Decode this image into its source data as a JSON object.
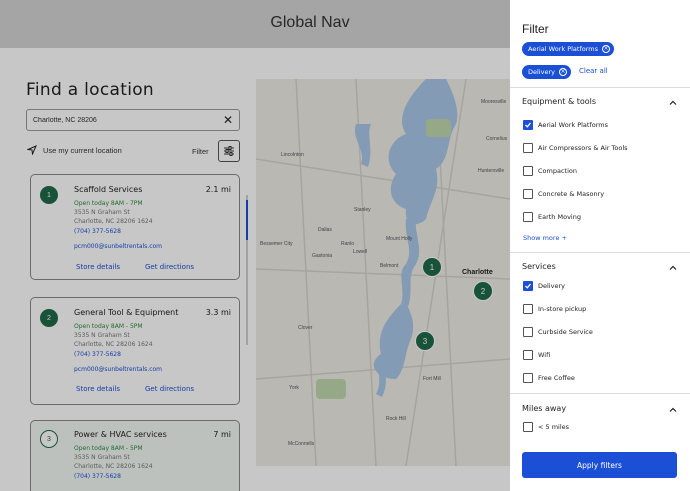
{
  "nav": {
    "title": "Global Nav"
  },
  "left": {
    "title": "Find a location",
    "search_value": "Charlotte, NC 28206",
    "use_location": "Use my current location",
    "filter_label": "Filter"
  },
  "cards": [
    {
      "num": "1",
      "name": "Scaffold Services",
      "dist": "2.1 mi",
      "open": "Open today 8AM - 7PM",
      "addr1": "3535 N Graham St",
      "addr2": "Charlotte, NC  28206 1624",
      "phone": "(704) 377-5628",
      "email": "pcm000@sunbeltrentals.com",
      "details": "Store details",
      "directions": "Get directions"
    },
    {
      "num": "2",
      "name": "General Tool & Equipment",
      "dist": "3.3 mi",
      "open": "Open today 8AM - 5PM",
      "addr1": "3535 N Graham St",
      "addr2": "Charlotte, NC  28206 1624",
      "phone": "(704) 377-5628",
      "email": "pcm000@sunbeltrentals.com",
      "details": "Store details",
      "directions": "Get directions"
    },
    {
      "num": "3",
      "name": "Power & HVAC services",
      "dist": "7 mi",
      "open": "Open today 8AM - 5PM",
      "addr1": "3535 N Graham St",
      "addr2": "Charlotte, NC  28206 1624",
      "phone": "(704) 377-5628"
    }
  ],
  "map": {
    "labels": [
      "Mooresville",
      "Cornelius",
      "Lincolnton",
      "Huntersville",
      "Stanley",
      "Dallas",
      "Mount Holly",
      "Bessemer City",
      "Ranlo",
      "Lowell",
      "Gastonia",
      "Belmont",
      "Charlotte",
      "Clover",
      "York",
      "Fort Mill",
      "Rock Hill",
      "McConnells"
    ],
    "pins": [
      "1",
      "2",
      "3"
    ],
    "water_color": "#a8c7e8",
    "land_color": "#efece6"
  },
  "filter": {
    "title": "Filter",
    "chips": [
      "Aerial Work Platforms",
      "Delivery"
    ],
    "clear_all": "Clear all",
    "sections": [
      {
        "title": "Equipment & tools",
        "options": [
          {
            "label": "Aerial Work Platforms",
            "checked": true
          },
          {
            "label": "Air Compressors & Air Tools",
            "checked": false
          },
          {
            "label": "Compaction",
            "checked": false
          },
          {
            "label": "Concrete & Masonry",
            "checked": false
          },
          {
            "label": "Earth Moving",
            "checked": false
          }
        ],
        "show_more": "Show more  +"
      },
      {
        "title": "Services",
        "options": [
          {
            "label": "Delivery",
            "checked": true
          },
          {
            "label": "In-store pickup",
            "checked": false
          },
          {
            "label": "Curbside Service",
            "checked": false
          },
          {
            "label": "Wifi",
            "checked": false
          },
          {
            "label": "Free Coffee",
            "checked": false
          }
        ]
      },
      {
        "title": "Miles away",
        "options": [
          {
            "label": "< 5 miles",
            "checked": false
          }
        ]
      }
    ],
    "apply": "Apply filters"
  },
  "colors": {
    "accent": "#1a4fd6",
    "pin": "#1f6b4a",
    "open_green": "#2b8a3e"
  }
}
